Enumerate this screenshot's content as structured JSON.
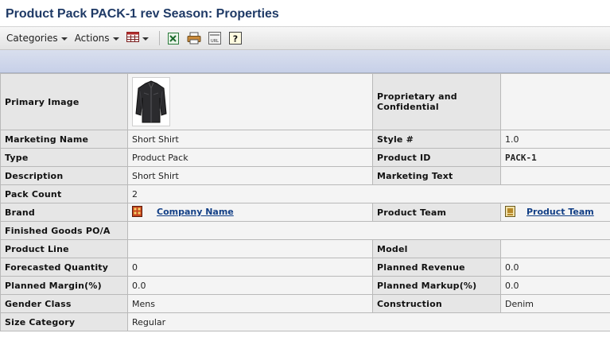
{
  "page_title": "Product Pack PACK-1 rev Season: Properties",
  "toolbar": {
    "categories_label": "Categories",
    "actions_label": "Actions",
    "icons": [
      "calendar-view-icon",
      "export-excel-icon",
      "print-icon",
      "url-icon",
      "help-icon"
    ]
  },
  "properties": {
    "primary_image_label": "Primary Image",
    "proprietary_label": "Proprietary and Confidential",
    "marketing_name_label": "Marketing Name",
    "marketing_name_value": "Short Shirt",
    "style_label": "Style #",
    "style_value": "1.0",
    "type_label": "Type",
    "type_value": "Product Pack",
    "product_id_label": "Product ID",
    "product_id_value": "PACK-1",
    "description_label": "Description",
    "description_value": "Short Shirt",
    "marketing_text_label": "Marketing Text",
    "pack_count_label": "Pack Count",
    "pack_count_value": "2",
    "brand_label": "Brand",
    "brand_value": "Company Name",
    "product_team_label": "Product Team",
    "product_team_value": "Product Team",
    "finished_goods_label": "Finished Goods PO/A",
    "product_line_label": "Product Line",
    "model_label": "Model",
    "forecasted_quantity_label": "Forecasted Quantity",
    "forecasted_quantity_value": "0",
    "planned_revenue_label": "Planned Revenue",
    "planned_revenue_value": "0.0",
    "planned_margin_label": "Planned Margin(%)",
    "planned_margin_value": "0.0",
    "planned_markup_label": "Planned Markup(%)",
    "planned_markup_value": "0.0",
    "gender_class_label": "Gender Class",
    "gender_class_value": "Mens",
    "construction_label": "Construction",
    "construction_value": "Denim",
    "size_category_label": "Size Category",
    "size_category_value": "Regular"
  },
  "colors": {
    "title": "#1f3a66",
    "link": "#123f86",
    "label_bg": "#e6e6e6",
    "value_bg": "#f4f4f4",
    "band": "#c9d2ea"
  }
}
